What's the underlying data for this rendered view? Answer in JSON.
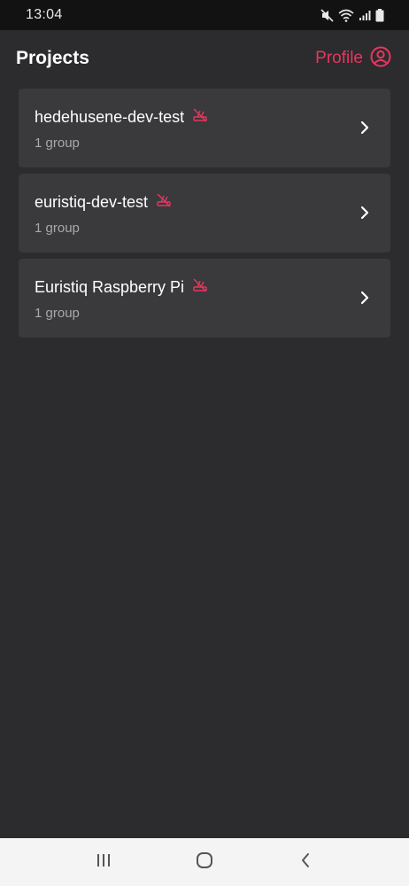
{
  "status_bar": {
    "time": "13:04",
    "icons": [
      "mute-icon",
      "wifi-icon",
      "signal-icon",
      "battery-icon"
    ]
  },
  "header": {
    "title": "Projects",
    "profile_label": "Profile",
    "profile_icon": "user-circle-icon"
  },
  "projects": [
    {
      "name": "hedehusene-dev-test",
      "meta": "1 group",
      "status_icon": "offline-router-icon"
    },
    {
      "name": "euristiq-dev-test",
      "meta": "1 group",
      "status_icon": "offline-router-icon"
    },
    {
      "name": "Euristiq Raspberry Pi",
      "meta": "1 group",
      "status_icon": "offline-router-icon"
    }
  ],
  "nav_bar": {
    "buttons": [
      "recent-apps-icon",
      "home-icon",
      "back-icon"
    ]
  },
  "colors": {
    "accent": "#e8365f",
    "background": "#2c2b2e",
    "card": "#3a393c",
    "status_bar": "#121212",
    "nav_bar": "#f4f4f4"
  }
}
